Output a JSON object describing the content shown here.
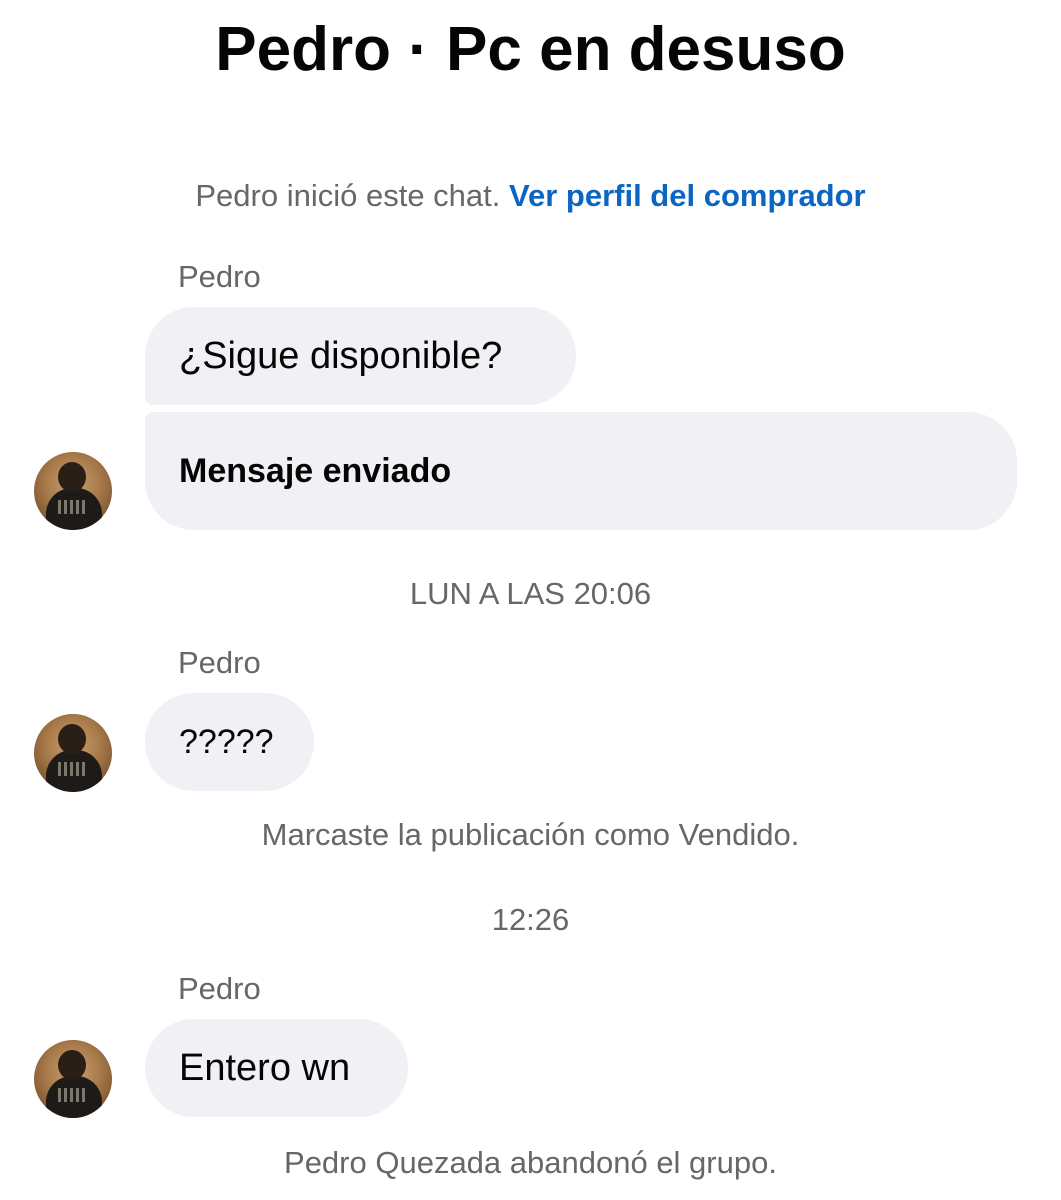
{
  "header": {
    "title": "Pedro · Pc en desuso"
  },
  "intro": {
    "text": "Pedro inició este chat.",
    "link": "Ver perfil del comprador"
  },
  "groups": [
    {
      "sender": "Pedro",
      "messages": [
        "¿Sigue disponible?",
        "Mensaje enviado"
      ]
    },
    {
      "sender": "Pedro",
      "messages": [
        "?????"
      ]
    },
    {
      "sender": "Pedro",
      "messages": [
        "Entero wn"
      ]
    }
  ],
  "timestamps": [
    "LUN A LAS 20:06",
    "12:26"
  ],
  "events": [
    "Marcaste la publicación como Vendido.",
    "Pedro Quezada abandonó el grupo."
  ],
  "colors": {
    "bubble": "#f0f0f5",
    "link": "#0a66c2",
    "meta_text": "#65676b"
  },
  "icons": {
    "avatar": "user-avatar-photo"
  }
}
